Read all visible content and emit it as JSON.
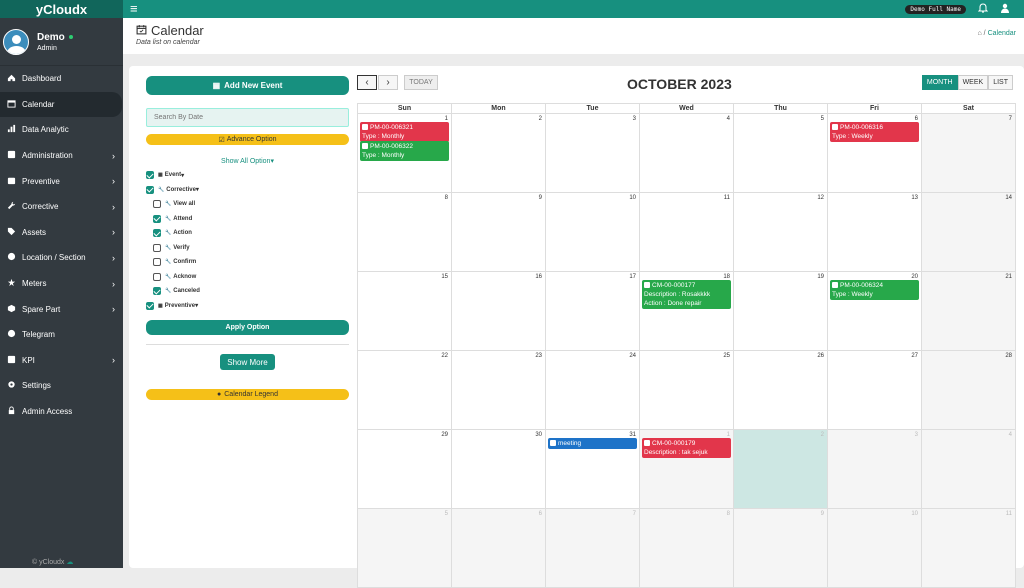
{
  "app": {
    "brand": "yCloudx",
    "user_full_name": "Demo Full Name"
  },
  "user": {
    "name": "Demo",
    "role": "Admin"
  },
  "sidebar": {
    "items": [
      {
        "label": "Dashboard",
        "icon": "dashboard-icon"
      },
      {
        "label": "Calendar",
        "icon": "calendar-icon",
        "active": true
      },
      {
        "label": "Data Analytic",
        "icon": "chart-icon"
      },
      {
        "label": "Administration",
        "icon": "admin-icon",
        "chevron": true
      },
      {
        "label": "Preventive",
        "icon": "preventive-icon",
        "chevron": true
      },
      {
        "label": "Corrective",
        "icon": "wrench-icon",
        "chevron": true
      },
      {
        "label": "Assets",
        "icon": "tag-icon",
        "chevron": true
      },
      {
        "label": "Location / Section",
        "icon": "location-icon",
        "chevron": true
      },
      {
        "label": "Meters",
        "icon": "meter-icon",
        "chevron": true
      },
      {
        "label": "Spare Part",
        "icon": "box-icon",
        "chevron": true
      },
      {
        "label": "Telegram",
        "icon": "telegram-icon"
      },
      {
        "label": "KPI",
        "icon": "kpi-icon",
        "chevron": true
      },
      {
        "label": "Settings",
        "icon": "gear-icon"
      },
      {
        "label": "Admin Access",
        "icon": "lock-icon"
      }
    ],
    "copyright": "© yCloudx"
  },
  "page": {
    "title": "Calendar",
    "subtitle": "Data list on calendar",
    "breadcrumb": "Calendar"
  },
  "filters": {
    "add_event": "Add New Event",
    "search_placeholder": "Search By Date",
    "advance_option": "Advance Option",
    "show_all": "Show All Option",
    "options": [
      {
        "label": "Event",
        "checked": true,
        "sub": false
      },
      {
        "label": "Corrective",
        "checked": true,
        "sub": false
      },
      {
        "label": "View all",
        "checked": false,
        "sub": true
      },
      {
        "label": "Attend",
        "checked": true,
        "sub": true
      },
      {
        "label": "Action",
        "checked": true,
        "sub": true
      },
      {
        "label": "Verify",
        "checked": false,
        "sub": true
      },
      {
        "label": "Confirm",
        "checked": false,
        "sub": true
      },
      {
        "label": "Acknow",
        "checked": false,
        "sub": true
      },
      {
        "label": "Canceled",
        "checked": true,
        "sub": true
      },
      {
        "label": "Preventive",
        "checked": true,
        "sub": false
      }
    ],
    "apply": "Apply Option",
    "show_more": "Show More",
    "legend": "Calendar Legend"
  },
  "calendar": {
    "month_label": "OCTOBER 2023",
    "today_label": "TODAY",
    "views": [
      "MONTH",
      "WEEK",
      "LIST"
    ],
    "active_view": "MONTH",
    "weekdays": [
      "Sun",
      "Mon",
      "Tue",
      "Wed",
      "Thu",
      "Fri",
      "Sat"
    ],
    "weeks": [
      [
        "1",
        "2",
        "3",
        "4",
        "5",
        "6",
        "7"
      ],
      [
        "8",
        "9",
        "10",
        "11",
        "12",
        "13",
        "14"
      ],
      [
        "15",
        "16",
        "17",
        "18",
        "19",
        "20",
        "21"
      ],
      [
        "22",
        "23",
        "24",
        "25",
        "26",
        "27",
        "28"
      ],
      [
        "29",
        "30",
        "31",
        "1",
        "2",
        "3",
        "4"
      ],
      [
        "5",
        "6",
        "7",
        "8",
        "9",
        "10",
        "11"
      ]
    ],
    "events": [
      {
        "week": 0,
        "day": 0,
        "slot": 0,
        "color": "red",
        "title": "PM-00-006321",
        "detail": "Type : Monthly"
      },
      {
        "week": 0,
        "day": 0,
        "slot": 1,
        "color": "green",
        "title": "PM-00-006322",
        "detail": "Type : Monthly"
      },
      {
        "week": 0,
        "day": 5,
        "slot": 0,
        "color": "red",
        "title": "PM-00-006316",
        "detail": "Type : Weekly"
      },
      {
        "week": 2,
        "day": 3,
        "slot": 0,
        "color": "green",
        "title": "CM-00-000177",
        "detail": "Description : Rosakkkk",
        "detail2": "Action : Done repair"
      },
      {
        "week": 2,
        "day": 5,
        "slot": 0,
        "color": "green",
        "title": "PM-00-006324",
        "detail": "Type : Weekly"
      },
      {
        "week": 4,
        "day": 2,
        "slot": 0,
        "color": "blue",
        "title": "meeting"
      },
      {
        "week": 4,
        "day": 3,
        "slot": 0,
        "color": "red",
        "title": "CM-00-000179",
        "detail": "Description : tak sejuk"
      }
    ]
  }
}
